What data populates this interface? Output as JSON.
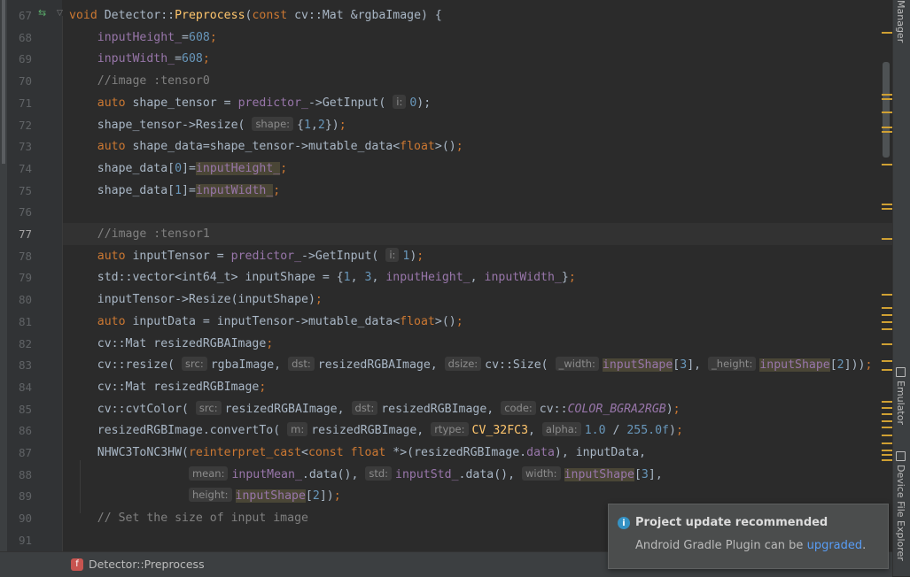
{
  "editor": {
    "lines": [
      {
        "n": "67",
        "s": [
          [
            "kw",
            "void "
          ],
          [
            "",
            "Detector::"
          ],
          [
            "fn",
            "Preprocess"
          ],
          [
            "",
            "("
          ],
          [
            "kw",
            "const "
          ],
          [
            "",
            "cv::Mat &rgbaImage) {"
          ]
        ]
      },
      {
        "n": "68",
        "s": [
          [
            "fld",
            "    inputHeight_"
          ],
          [
            "",
            "="
          ],
          [
            "num",
            "608"
          ],
          [
            "kw",
            ";"
          ]
        ]
      },
      {
        "n": "69",
        "s": [
          [
            "fld",
            "    inputWidth_"
          ],
          [
            "",
            "="
          ],
          [
            "num",
            "608"
          ],
          [
            "kw",
            ";"
          ]
        ]
      },
      {
        "n": "70",
        "s": [
          [
            "cm",
            "    //image :tensor0"
          ]
        ]
      },
      {
        "n": "71",
        "s": [
          [
            "kw",
            "    auto "
          ],
          [
            "",
            "shape_tensor = "
          ],
          [
            "fld",
            "predictor_"
          ],
          [
            "",
            "->GetInput( "
          ],
          [
            "hint",
            "i:"
          ],
          [
            "num",
            "0"
          ],
          [
            "",
            "); "
          ]
        ]
      },
      {
        "n": "72",
        "s": [
          [
            "",
            "    shape_tensor->Resize( "
          ],
          [
            "hint",
            "shape:"
          ],
          [
            "",
            "{"
          ],
          [
            "num",
            "1"
          ],
          [
            "",
            ","
          ],
          [
            "num",
            "2"
          ],
          [
            "",
            "})"
          ],
          [
            "kw",
            ";"
          ]
        ]
      },
      {
        "n": "73",
        "s": [
          [
            "kw",
            "    auto "
          ],
          [
            "",
            "shape_data=shape_tensor->mutable_data<"
          ],
          [
            "kw",
            "float"
          ],
          [
            "",
            ">()"
          ],
          [
            "kw",
            ";"
          ]
        ]
      },
      {
        "n": "74",
        "s": [
          [
            "",
            "    shape_data["
          ],
          [
            "num",
            "0"
          ],
          [
            "",
            "]="
          ],
          [
            "hl",
            "inputHeight_"
          ],
          [
            "kw",
            ";"
          ]
        ]
      },
      {
        "n": "75",
        "s": [
          [
            "",
            "    shape_data["
          ],
          [
            "num",
            "1"
          ],
          [
            "",
            "]="
          ],
          [
            "hl",
            "inputWidth_"
          ],
          [
            "kw",
            ";"
          ]
        ]
      },
      {
        "n": "76",
        "s": []
      },
      {
        "n": "77",
        "s": [
          [
            "cm",
            "    //image :tensor1"
          ]
        ]
      },
      {
        "n": "78",
        "s": [
          [
            "kw",
            "    auto "
          ],
          [
            "",
            "inputTensor = "
          ],
          [
            "fld",
            "predictor_"
          ],
          [
            "",
            "->GetInput( "
          ],
          [
            "hint",
            "i:"
          ],
          [
            "num",
            "1"
          ],
          [
            "",
            ")"
          ],
          [
            "kw",
            ";"
          ]
        ]
      },
      {
        "n": "79",
        "s": [
          [
            "",
            "    std::vector<int64_t> inputShape = {"
          ],
          [
            "num",
            "1"
          ],
          [
            "",
            ", "
          ],
          [
            "num",
            "3"
          ],
          [
            "",
            ", "
          ],
          [
            "fld",
            "inputHeight_"
          ],
          [
            "",
            ", "
          ],
          [
            "fld",
            "inputWidth_"
          ],
          [
            "",
            "}"
          ],
          [
            "kw",
            ";"
          ]
        ]
      },
      {
        "n": "80",
        "s": [
          [
            "",
            "    inputTensor->Resize(inputShape)"
          ],
          [
            "kw",
            ";"
          ]
        ]
      },
      {
        "n": "81",
        "s": [
          [
            "kw",
            "    auto "
          ],
          [
            "",
            "inputData = inputTensor->mutable_data<"
          ],
          [
            "kw",
            "float"
          ],
          [
            "",
            ">()"
          ],
          [
            "kw",
            ";"
          ]
        ]
      },
      {
        "n": "82",
        "s": [
          [
            "",
            "    cv::Mat resizedRGBAImage"
          ],
          [
            "kw",
            ";"
          ]
        ]
      },
      {
        "n": "83",
        "s": [
          [
            "",
            "    cv::resize( "
          ],
          [
            "hint",
            "src:"
          ],
          [
            "",
            "rgbaImage, "
          ],
          [
            "hint",
            "dst:"
          ],
          [
            "",
            "resizedRGBAImage, "
          ],
          [
            "hint",
            "dsize:"
          ],
          [
            "",
            "cv::Size( "
          ],
          [
            "hint",
            "_width:"
          ],
          [
            "hl",
            "inputShape"
          ],
          [
            "",
            "["
          ],
          [
            "num",
            "3"
          ],
          [
            "",
            "], "
          ],
          [
            "hint",
            "_height:"
          ],
          [
            "hl",
            "inputShape"
          ],
          [
            "",
            "["
          ],
          [
            "num",
            "2"
          ],
          [
            "",
            "]))"
          ],
          [
            "kw",
            ";"
          ]
        ]
      },
      {
        "n": "84",
        "s": [
          [
            "",
            "    cv::Mat resizedRGBImage"
          ],
          [
            "kw",
            ";"
          ]
        ]
      },
      {
        "n": "85",
        "s": [
          [
            "",
            "    cv::cvtColor( "
          ],
          [
            "hint",
            "src:"
          ],
          [
            "",
            "resizedRGBAImage, "
          ],
          [
            "hint",
            "dst:"
          ],
          [
            "",
            "resizedRGBImage, "
          ],
          [
            "hint",
            "code:"
          ],
          [
            "",
            "cv::"
          ],
          [
            "enm",
            "COLOR_BGRA2RGB"
          ],
          [
            "",
            ")"
          ],
          [
            "kw",
            ";"
          ]
        ]
      },
      {
        "n": "86",
        "s": [
          [
            "",
            "    resizedRGBImage.convertTo( "
          ],
          [
            "hint",
            "m:"
          ],
          [
            "",
            "resizedRGBImage, "
          ],
          [
            "hint",
            "rtype:"
          ],
          [
            "fn",
            "CV_32FC3"
          ],
          [
            "",
            ", "
          ],
          [
            "hint",
            "alpha:"
          ],
          [
            "num",
            "1.0"
          ],
          [
            "",
            " / "
          ],
          [
            "num",
            "255.0f"
          ],
          [
            "",
            ")"
          ],
          [
            "kw",
            ";"
          ]
        ]
      },
      {
        "n": "87",
        "s": [
          [
            "",
            "    NHWC3ToNC3HW("
          ],
          [
            "kw",
            "reinterpret_cast"
          ],
          [
            "",
            "<"
          ],
          [
            "kw",
            "const float "
          ],
          [
            "",
            "*>(resizedRGBImage."
          ],
          [
            "fld",
            "data"
          ],
          [
            "",
            "), inputData,"
          ]
        ]
      },
      {
        "n": "88",
        "s": [
          [
            "",
            "                 "
          ],
          [
            "hint",
            "mean:"
          ],
          [
            "fld",
            "inputMean_"
          ],
          [
            "",
            ".data(), "
          ],
          [
            "hint",
            "std:"
          ],
          [
            "fld",
            "inputStd_"
          ],
          [
            "",
            ".data(), "
          ],
          [
            "hint",
            "width:"
          ],
          [
            "hl",
            "inputShape"
          ],
          [
            "",
            "["
          ],
          [
            "num",
            "3"
          ],
          [
            "",
            "],"
          ]
        ]
      },
      {
        "n": "89",
        "s": [
          [
            "",
            "                 "
          ],
          [
            "hint",
            "height:"
          ],
          [
            "hl",
            "inputShape"
          ],
          [
            "",
            "["
          ],
          [
            "num",
            "2"
          ],
          [
            "",
            "])"
          ],
          [
            "kw",
            ";"
          ]
        ]
      },
      {
        "n": "90",
        "s": [
          [
            "cm",
            "    // Set the size of input image"
          ]
        ]
      },
      {
        "n": "91",
        "s": []
      }
    ],
    "current_line": "77"
  },
  "breadcrumb": {
    "icon_letter": "f",
    "label": "Detector::Preprocess"
  },
  "right_tabs": {
    "manager": "Manager",
    "emulator": "Emulator",
    "device_file_explorer": "Device File Explorer"
  },
  "notification": {
    "title": "Project update recommended",
    "body_prefix": "Android Gradle Plugin can be ",
    "link": "upgraded",
    "body_suffix": "."
  },
  "colors": {
    "background": "#2b2b2b",
    "keyword": "#cc7832",
    "function": "#ffc66d",
    "number": "#6897bb",
    "comment": "#808080",
    "field": "#9876aa",
    "link": "#589df6",
    "marker": "#cfa033"
  },
  "icons": {
    "override": "override-arrows-icon",
    "fold": "fold-icon",
    "info": "info-icon",
    "function": "function-icon"
  }
}
